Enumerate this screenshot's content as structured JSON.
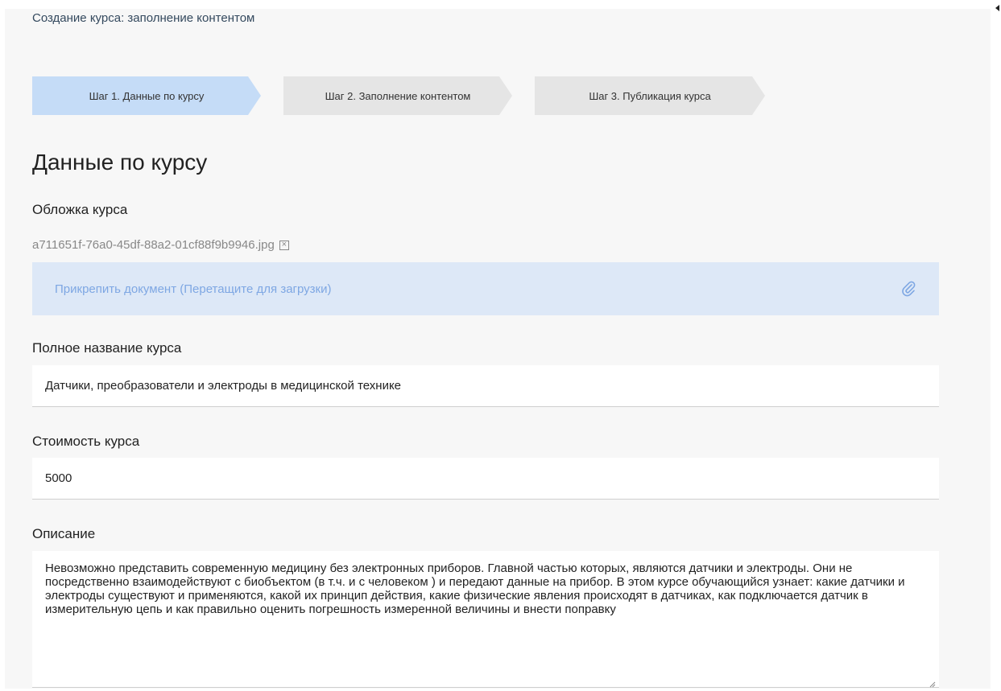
{
  "header": {
    "title": "Создание курса: заполнение контентом"
  },
  "steps": [
    {
      "label": "Шаг 1. Данные по курсу",
      "active": true
    },
    {
      "label": "Шаг 2. Заполнение контентом",
      "active": false
    },
    {
      "label": "Шаг 3. Публикация курса",
      "active": false
    }
  ],
  "form": {
    "section_title": "Данные по курсу",
    "cover": {
      "label": "Обложка курса",
      "file_name": "a711651f-76a0-45df-88a2-01cf88f9b9946.jpg",
      "dropzone_text": "Прикрепить документ (Перетащите для загрузки)"
    },
    "full_name": {
      "label": "Полное название курса",
      "value": "Датчики, преобразователи и электроды в медицинской технике"
    },
    "price": {
      "label": "Стоимость курса",
      "value": "5000"
    },
    "description": {
      "label": "Описание",
      "value": "Невозможно представить современную медицину без электронных приборов. Главной частью которых, являются датчики и электроды. Они не посредственно взаимодействуют с биобъектом (в т.ч. и с человеком ) и передают данные на прибор. В этом курсе обучающийся узнает: какие датчики и электроды существуют и применяются, какой их принцип действия, какие физические явления  происходят в датчиках, как подключается датчик в измерительную цепь и как правильно оценить погрешность измеренной величины и внести поправку"
    }
  },
  "colors": {
    "step_active": "#c5dcf7",
    "step_inactive": "#e5e5e5",
    "dropzone_bg": "#dde8f7",
    "dropzone_text": "#7ea7e3",
    "page_bg": "#f7f7f7"
  },
  "icons": {
    "file_remove": "close-box-icon",
    "attach": "paperclip-icon"
  }
}
